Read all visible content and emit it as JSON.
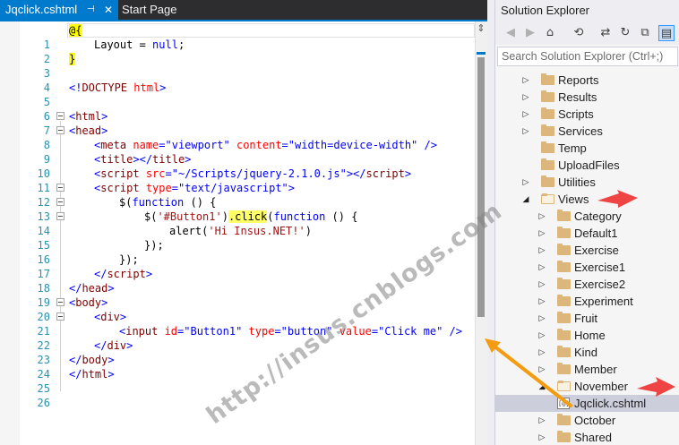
{
  "tabs": {
    "active": {
      "label": "Jqclick.cshtml",
      "pin_glyph": "⊣",
      "close_glyph": "✕"
    },
    "inactive": {
      "label": "Start Page"
    }
  },
  "editor": {
    "line_numbers": [
      "1",
      "2",
      "3",
      "4",
      "5",
      "6",
      "7",
      "8",
      "9",
      "10",
      "11",
      "12",
      "13",
      "14",
      "15",
      "16",
      "17",
      "18",
      "19",
      "20",
      "21",
      "22",
      "23",
      "24",
      "25",
      "26"
    ],
    "tokens": {
      "l1_at": "@{",
      "l2_a": "Layout = ",
      "l2_null": "null",
      "l2_b": ";",
      "l3": "}",
      "l5_a": "<!",
      "l5_doctype": "DOCTYPE",
      "l5_sp": " ",
      "l5_html": "html",
      "l5_b": ">",
      "lt": "<",
      "gt": ">",
      "lts": "</",
      "sgt": " />",
      "eq": "=",
      "html": "html",
      "head": "head",
      "meta": "meta",
      "title": "title",
      "script": "script",
      "body": "body",
      "div": "div",
      "input": "input",
      "a_name": " name",
      "v_viewport": "\"viewport\"",
      "a_content": " content",
      "v_content": "\"width=device-width\"",
      "a_src": " src",
      "v_src": "\"~/Scripts/jquery-2.1.0.js\"",
      "a_type": " type",
      "v_textjs": "\"text/javascript\"",
      "l13_a": "$(",
      "l13_fn": "function",
      "l13_b": " () {",
      "l14_a": "$(",
      "l14_str": "'#Button1'",
      "l14_b": ")",
      "l14_click": ".click",
      "l14_c": "(",
      "l14_fn": "function",
      "l14_d": " () {",
      "l15_a": "alert(",
      "l15_str": "'Hi Insus.NET!'",
      "l15_b": ")",
      "l16": "});",
      "l17": "});",
      "a_id": " id",
      "v_button1": "\"Button1\"",
      "v_button": "\"button\"",
      "a_value": " value",
      "v_clickme": "\"Click me\""
    }
  },
  "solution_explorer": {
    "title": "Solution Explorer",
    "search_placeholder": "Search Solution Explorer (Ctrl+;)",
    "toolbar": {
      "back": "◀",
      "forward": "▶",
      "home": "⌂",
      "history": "⟲",
      "sync": "⇄",
      "refresh": "↻",
      "collapse": "⧉",
      "properties": "▤"
    },
    "items": [
      {
        "label": "Reports",
        "expander": "▷"
      },
      {
        "label": "Results",
        "expander": "▷"
      },
      {
        "label": "Scripts",
        "expander": "▷"
      },
      {
        "label": "Services",
        "expander": "▷"
      },
      {
        "label": "Temp",
        "expander": ""
      },
      {
        "label": "UploadFiles",
        "expander": ""
      },
      {
        "label": "Utilities",
        "expander": "▷"
      },
      {
        "label": "Views",
        "expander": "◢"
      },
      {
        "label": "Category",
        "expander": "▷"
      },
      {
        "label": "Default1",
        "expander": "▷"
      },
      {
        "label": "Exercise",
        "expander": "▷"
      },
      {
        "label": "Exercise1",
        "expander": "▷"
      },
      {
        "label": "Exercise2",
        "expander": "▷"
      },
      {
        "label": "Experiment",
        "expander": "▷"
      },
      {
        "label": "Fruit",
        "expander": "▷"
      },
      {
        "label": "Home",
        "expander": "▷"
      },
      {
        "label": "Kind",
        "expander": "▷"
      },
      {
        "label": "Member",
        "expander": "▷"
      },
      {
        "label": "November",
        "expander": "◢"
      },
      {
        "label": "Jqclick.cshtml",
        "badge": "[@]"
      },
      {
        "label": "October",
        "expander": "▷"
      },
      {
        "label": "Shared",
        "expander": "▷"
      }
    ]
  },
  "watermark": "http://insus.cnblogs.com",
  "colors": {
    "tab_active": "#007acc",
    "annotation_arrow": "#ef4444",
    "pointer_arrow": "#f39c12"
  }
}
